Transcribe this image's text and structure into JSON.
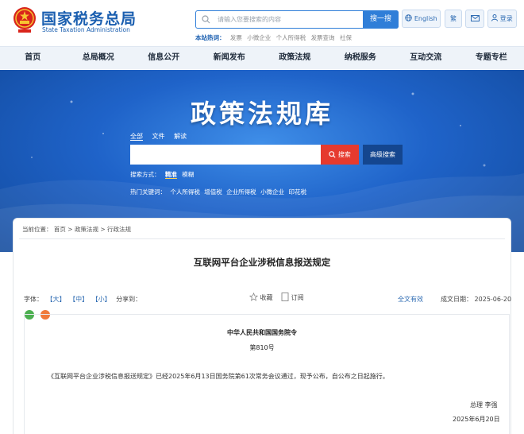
{
  "header": {
    "site_name": "国家税务总局",
    "site_name_en": "State Taxation Administration",
    "search_placeholder": "请输入您要搜索的内容",
    "search_button": "搜一搜",
    "hot_label": "本站热词：",
    "hot_words": [
      "发票",
      "小微企业",
      "个人所得税",
      "发票查询",
      "社保"
    ],
    "english_label": "English",
    "traditional_label": "繁",
    "login_label": "登录"
  },
  "nav": {
    "items": [
      "首页",
      "总局概况",
      "信息公开",
      "新闻发布",
      "政策法规",
      "纳税服务",
      "互动交流",
      "专题专栏"
    ]
  },
  "banner": {
    "title": "政策法规库",
    "scope_tabs": [
      "全部",
      "文件",
      "解读"
    ],
    "search_button": "搜索",
    "advanced_button": "高级搜索",
    "method_label": "搜索方式：",
    "method_options": [
      "精准",
      "模糊"
    ],
    "keywords_label": "热门关键词：",
    "keywords": [
      "个人所得税",
      "增值税",
      "企业所得税",
      "小微企业",
      "印花税"
    ]
  },
  "breadcrumb": {
    "prefix": "当前位置：",
    "items": [
      "首页",
      "政策法规",
      "行政法规"
    ],
    "separator": ">"
  },
  "article": {
    "title": "互联网平台企业涉税信息报送规定",
    "font_label": "字体：",
    "font_sizes": [
      "【大】",
      "【中】",
      "【小】"
    ],
    "share_label": "分享到：",
    "favorite": "收藏",
    "subscribe": "订阅",
    "fulltext": "全文有效",
    "date_label": "成文日期：",
    "date": "2025-06-20",
    "issuer": "中华人民共和国国务院令",
    "order_no": "第810号",
    "body": "《互联网平台企业涉税信息报送规定》已经2025年6月13日国务院第61次常务会议通过，现予公布，自公布之日起施行。",
    "sign_role": "总理 李强",
    "sign_date": "2025年6月20日"
  },
  "colors": {
    "brand_blue": "#1b5fb0",
    "search_blue": "#2f7ed8",
    "search_red": "#e63a2e",
    "wechat_green": "#4caf50",
    "weibo_orange": "#f07a3a"
  }
}
